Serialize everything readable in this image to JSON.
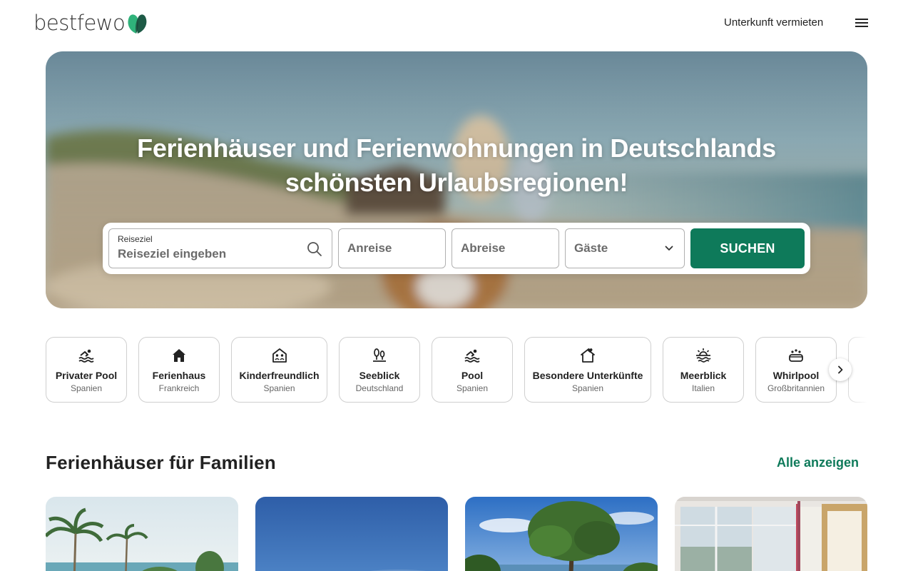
{
  "header": {
    "logo_text": "bestfewo",
    "host_link": "Unterkunft vermieten"
  },
  "hero": {
    "title_line1": "Ferienhäuser und Ferienwohnungen in Deutschlands",
    "title_line2": "schönsten Urlaubsregionen!"
  },
  "search": {
    "destination_label": "Reiseziel",
    "destination_placeholder": "Reiseziel eingeben",
    "arrival_placeholder": "Anreise",
    "departure_placeholder": "Abreise",
    "guests_placeholder": "Gäste",
    "button_label": "SUCHEN"
  },
  "categories": [
    {
      "name": "Privater Pool",
      "sub": "Spanien",
      "icon": "pool-icon"
    },
    {
      "name": "Ferienhaus",
      "sub": "Frankreich",
      "icon": "house-icon"
    },
    {
      "name": "Kinderfreundlich",
      "sub": "Spanien",
      "icon": "family-icon"
    },
    {
      "name": "Seeblick",
      "sub": "Deutschland",
      "icon": "lake-view-icon"
    },
    {
      "name": "Pool",
      "sub": "Spanien",
      "icon": "pool-icon"
    },
    {
      "name": "Besondere Unterkünfte",
      "sub": "Spanien",
      "icon": "heart-house-icon"
    },
    {
      "name": "Meerblick",
      "sub": "Italien",
      "icon": "sea-view-icon"
    },
    {
      "name": "Whirlpool",
      "sub": "Großbritannien",
      "icon": "whirlpool-icon"
    }
  ],
  "section": {
    "title": "Ferienhäuser für Familien",
    "show_all": "Alle anzeigen"
  },
  "colors": {
    "brand_green": "#0e7a5a",
    "logo_dark_green": "#1d5a46",
    "logo_light_green": "#2fb27a"
  }
}
